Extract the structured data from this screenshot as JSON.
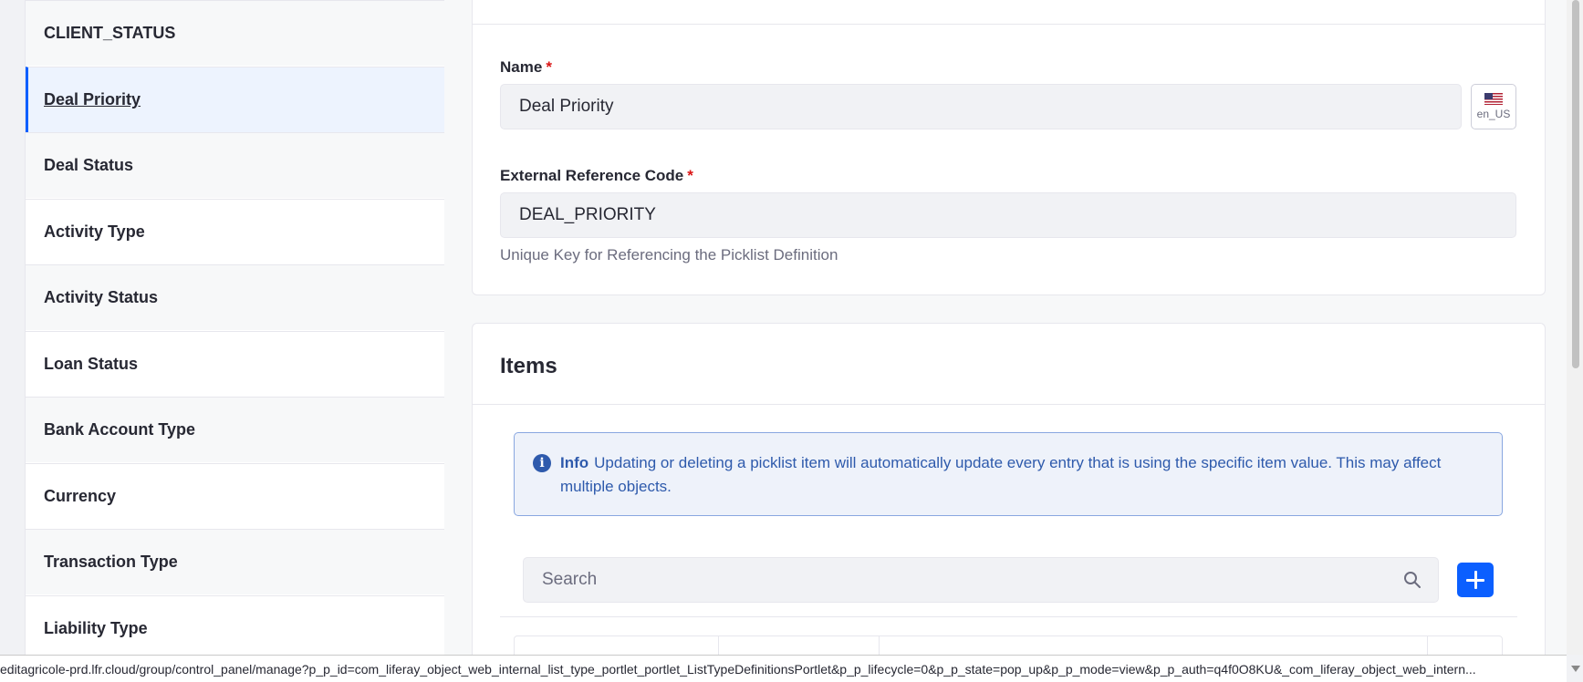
{
  "sidebar": {
    "items": [
      {
        "label": "CLIENT_STATUS"
      },
      {
        "label": "Deal Priority",
        "active": true
      },
      {
        "label": "Deal Status"
      },
      {
        "label": "Activity Type"
      },
      {
        "label": "Activity Status"
      },
      {
        "label": "Loan Status"
      },
      {
        "label": "Bank Account Type"
      },
      {
        "label": "Currency"
      },
      {
        "label": "Transaction Type"
      },
      {
        "label": "Liability Type"
      }
    ]
  },
  "form": {
    "name_label": "Name",
    "required_marker": "*",
    "name_value": "Deal Priority",
    "locale": "en_US",
    "erc_label": "External Reference Code",
    "erc_value": "DEAL_PRIORITY",
    "erc_help": "Unique Key for Referencing the Picklist Definition"
  },
  "items": {
    "title": "Items",
    "alert_title": "Info",
    "alert_text": "Updating or deleting a picklist item will automatically update every entry that is using the specific item value. This may affect multiple objects.",
    "search_placeholder": "Search"
  },
  "status_bar": {
    "url": "editagricole-prd.lfr.cloud/group/control_panel/manage?p_p_id=com_liferay_object_web_internal_list_type_portlet_portlet_ListTypeDefinitionsPortlet&p_p_lifecycle=0&p_p_state=pop_up&p_p_mode=view&p_p_auth=q4f0O8KU&_com_liferay_object_web_intern..."
  },
  "icons": {
    "locale_flag": "us-flag-icon",
    "info": "info-icon",
    "search": "search-icon",
    "add": "plus-icon"
  },
  "colors": {
    "primary": "#0b5fff",
    "required": "#da1414",
    "info": "#2e5aac",
    "active_bg": "#edf3fe"
  }
}
